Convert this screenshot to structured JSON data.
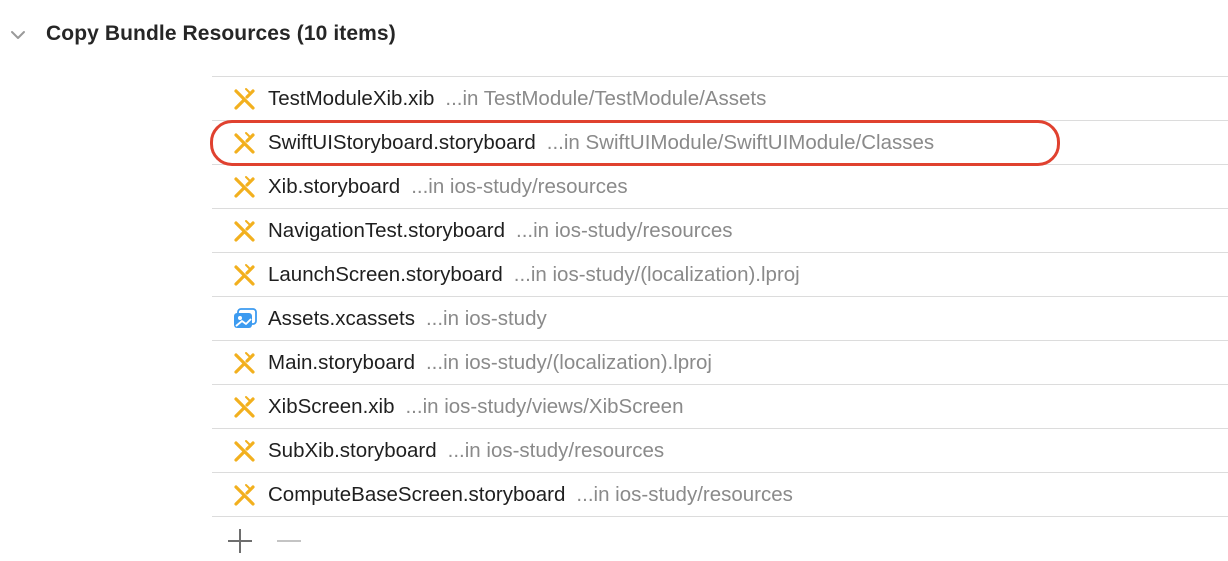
{
  "section": {
    "title": "Copy Bundle Resources (10 items)",
    "disclosure_icon": "chevron-down-icon"
  },
  "files": [
    {
      "name": "TestModuleXib.xib",
      "path": "...in TestModule/TestModule/Assets",
      "icon": "interface-builder-icon"
    },
    {
      "name": "SwiftUIStoryboard.storyboard",
      "path": "...in SwiftUIModule/SwiftUIModule/Classes",
      "icon": "interface-builder-icon"
    },
    {
      "name": "Xib.storyboard",
      "path": "...in ios-study/resources",
      "icon": "interface-builder-icon"
    },
    {
      "name": "NavigationTest.storyboard",
      "path": "...in ios-study/resources",
      "icon": "interface-builder-icon"
    },
    {
      "name": "LaunchScreen.storyboard",
      "path": "...in ios-study/(localization).lproj",
      "icon": "interface-builder-icon"
    },
    {
      "name": "Assets.xcassets",
      "path": "...in ios-study",
      "icon": "asset-catalog-icon"
    },
    {
      "name": "Main.storyboard",
      "path": "...in ios-study/(localization).lproj",
      "icon": "interface-builder-icon"
    },
    {
      "name": "XibScreen.xib",
      "path": "...in ios-study/views/XibScreen",
      "icon": "interface-builder-icon"
    },
    {
      "name": "SubXib.storyboard",
      "path": "...in ios-study/resources",
      "icon": "interface-builder-icon"
    },
    {
      "name": "ComputeBaseScreen.storyboard",
      "path": "...in ios-study/resources",
      "icon": "interface-builder-icon"
    }
  ],
  "footer": {
    "add_icon": "plus-icon",
    "remove_icon": "minus-icon"
  },
  "colors": {
    "highlight_ring": "#e0412f",
    "interface_builder_icon": "#f2b01e",
    "asset_catalog_icon": "#3d9bf0",
    "path_text": "#8a8a8a",
    "divider": "#dcdcdc"
  }
}
